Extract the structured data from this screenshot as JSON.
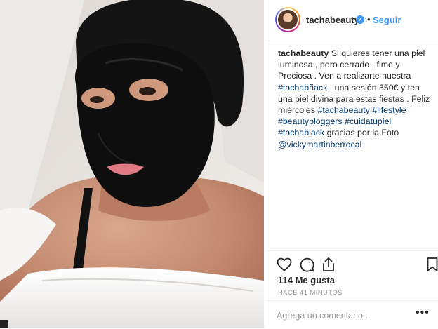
{
  "post": {
    "image_alt": "Woman in white bed with black face mask",
    "header": {
      "username": "tachabeauty",
      "verified": true,
      "separator": "•",
      "follow_label": "Seguir"
    },
    "caption": {
      "username": "tachabeauty",
      "segments": [
        {
          "text": " Si quieres tener una piel luminosa , poro cerrado , fime y Preciosa . Ven a realizarte nuestra ",
          "tag": false
        },
        {
          "text": "#tachabñack",
          "tag": true
        },
        {
          "text": " , una sesión 350€ y ten una piel divina para estas fiestas . Feliz miércoles ",
          "tag": false
        },
        {
          "text": "#tachabeauty",
          "tag": true
        },
        {
          "text": " ",
          "tag": false
        },
        {
          "text": "#lifestyle",
          "tag": true
        },
        {
          "text": " ",
          "tag": false
        },
        {
          "text": "#beautybloggers",
          "tag": true
        },
        {
          "text": " ",
          "tag": false
        },
        {
          "text": "#cuidatupiel",
          "tag": true
        },
        {
          "text": " ",
          "tag": false
        },
        {
          "text": "#tachablack",
          "tag": true
        },
        {
          "text": " gracias por la Foto ",
          "tag": false
        },
        {
          "text": "@vickymartinberrocal",
          "tag": true
        }
      ]
    },
    "actions": {
      "like_icon": "heart-icon",
      "comment_icon": "comment-icon",
      "share_icon": "share-icon",
      "save_icon": "bookmark-icon"
    },
    "likes_label": "114 Me gusta",
    "timestamp": "HACE 41 MINUTOS",
    "comment": {
      "placeholder": "Agrega un comentario...",
      "more_label": "•••"
    }
  },
  "colors": {
    "accent": "#3897f0",
    "hashtag": "#003569",
    "muted": "#999999",
    "border": "#efefef"
  }
}
